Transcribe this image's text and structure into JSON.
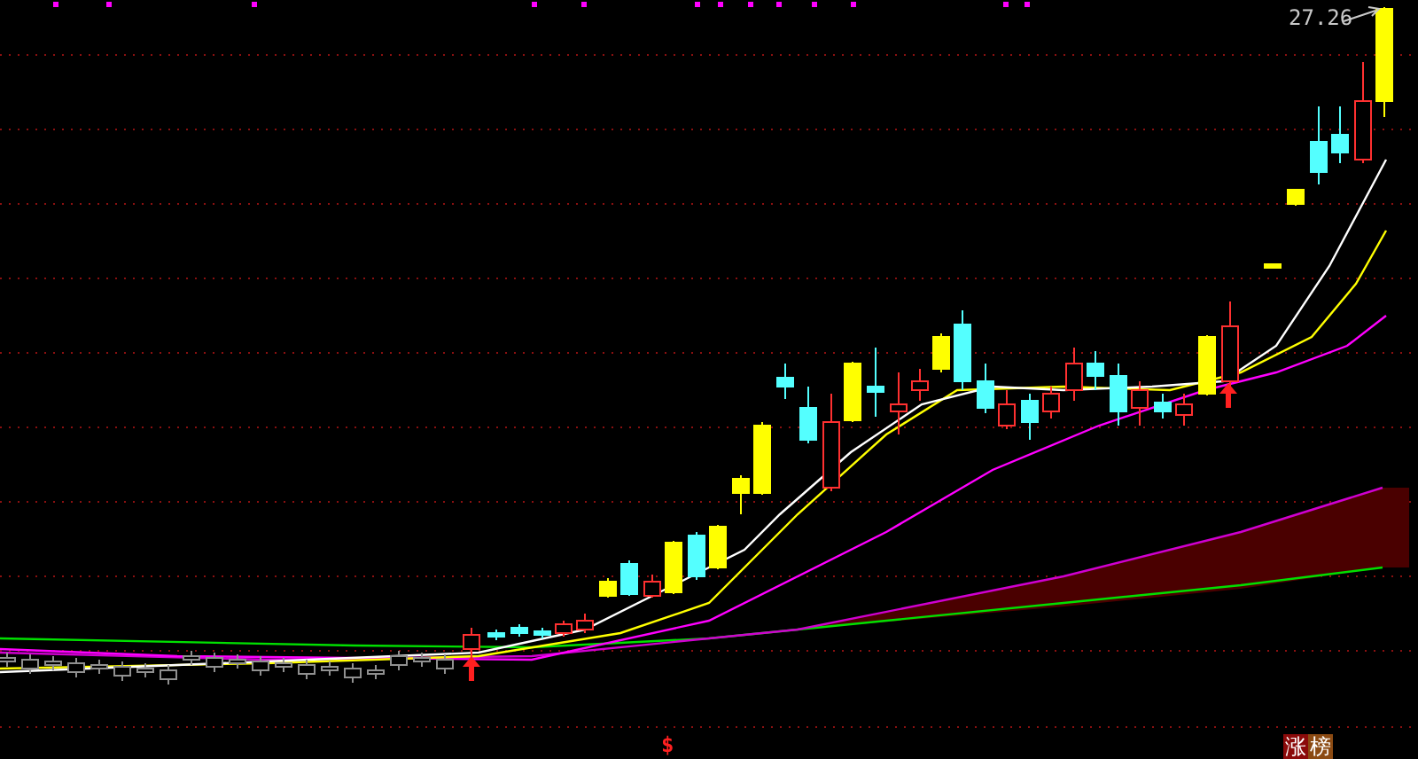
{
  "chart": {
    "price_label": "27.26",
    "signal_marker": "$",
    "badges": [
      {
        "text": "涨",
        "color": "#8b0a0a"
      },
      {
        "text": "榜",
        "color": "#8b4a12"
      }
    ]
  }
}
